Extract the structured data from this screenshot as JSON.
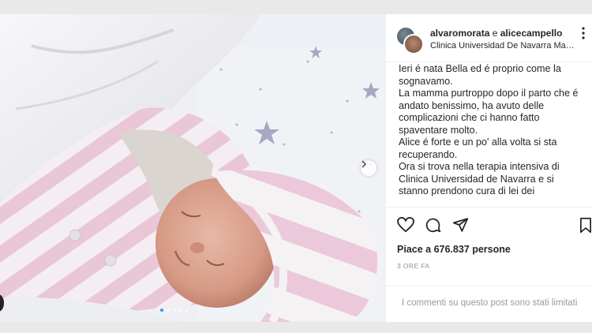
{
  "post": {
    "users": {
      "first": "alvaromorata",
      "connector": "e",
      "second": "alicecampello"
    },
    "location": "Clinica Universidad De Navarra Mad...",
    "more_icon": "more-options-icon",
    "caption": [
      "Ieri é nata Bella ed é proprio come la sognavamo.",
      "La mamma purtroppo dopo il parto che é andato benissimo, ha avuto delle complicazioni che ci hanno fatto spaventare molto.",
      "Alice é forte e un po' alla volta si sta recuperando.",
      "Ora si trova nella terapia intensiva di Clinica Universidad de Navarra e si stanno prendono cura di lei dei"
    ],
    "actions": {
      "like_icon": "heart-icon",
      "comment_icon": "comment-icon",
      "share_icon": "share-icon",
      "save_icon": "bookmark-icon"
    },
    "likes_text": "Piace a 676.837 persone",
    "time_ago": "3 ORE FA",
    "comments_disabled": "I commenti su questo post sono stati limitati"
  },
  "carousel": {
    "slide_count": 5,
    "active_index": 0
  },
  "colors": {
    "accent": "#3897f0",
    "muted_text": "#8e8e8e",
    "divider": "#efefef"
  }
}
